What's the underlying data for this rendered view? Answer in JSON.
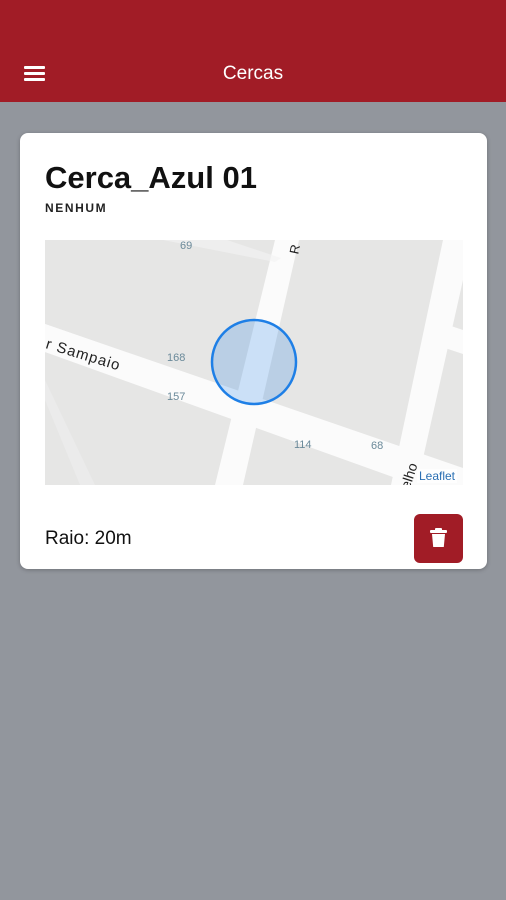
{
  "appbar": {
    "title": "Cercas",
    "menu_icon": "menu-icon",
    "color": "#a11c26"
  },
  "fence": {
    "name": "Cerca_Azul 01",
    "subtitle": "NENHUM",
    "radius_label": "Raio: 20m",
    "delete_icon": "trash-icon",
    "delete_color": "#a11c26"
  },
  "map": {
    "street_label": "r Sampaio",
    "street_label_2": "elho",
    "street_label_3": "R",
    "house_numbers": [
      "69",
      "168",
      "157",
      "114",
      "68"
    ],
    "attribution": "Leaflet",
    "circle_color": "#1e7fe6"
  }
}
